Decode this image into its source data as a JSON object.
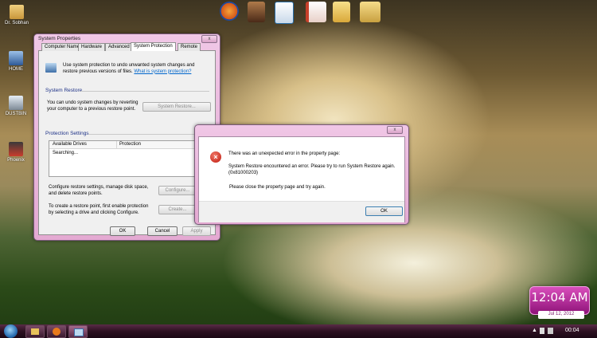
{
  "desktop": {
    "icons": [
      {
        "label": "Dr. Sobhan",
        "color": "#d9b25a"
      },
      {
        "label": "HOME",
        "color": "#4a6fa8"
      },
      {
        "label": "DUSTBIN",
        "color": "#9aa7b3"
      },
      {
        "label": "Phoenix",
        "color": "#c93c2c"
      }
    ],
    "top_launch": [
      {
        "name": "firefox-icon",
        "color": "#e87a1c"
      },
      {
        "name": "video-icon",
        "color": "#7a4a2a"
      },
      {
        "name": "app-icon",
        "color": "#2a6ea8"
      },
      {
        "name": "document-icon",
        "color": "#c8402a"
      },
      {
        "name": "folder-icon",
        "color": "#e8c25a"
      },
      {
        "name": "folder-pictures-icon",
        "color": "#d8b860"
      }
    ]
  },
  "system_properties": {
    "title": "System Properties",
    "close": "x",
    "tabs": [
      "Computer Name",
      "Hardware",
      "Advanced",
      "System Protection",
      "Remote"
    ],
    "intro": "Use system protection to undo unwanted system changes and restore previous versions of files.",
    "intro_link": "What is system protection?",
    "restore_group": "System Restore",
    "restore_text": "You can undo system changes by reverting your computer to a previous restore point.",
    "restore_button": "System Restore...",
    "protection_group": "Protection Settings",
    "columns": [
      "Available Drives",
      "Protection"
    ],
    "list_status": "Searching...",
    "configure_text": "Configure restore settings, manage disk space, and delete restore points.",
    "configure_button": "Configure...",
    "create_text": "To create a restore point, first enable protection by selecting a drive and clicking Configure.",
    "create_button": "Create...",
    "ok": "OK",
    "cancel": "Cancel",
    "apply": "Apply"
  },
  "error_dialog": {
    "close": "x",
    "heading": "There was an unexpected error in the property page:",
    "message": "System Restore encountered an error. Please try to run System Restore again. (0x81000203)",
    "note": "Please close the property page and try again.",
    "ok": "OK"
  },
  "clock_gadget": {
    "time": "12:04 AM",
    "date": "Jul 12, 2012"
  },
  "taskbar": {
    "time": "00:04",
    "colors": {
      "accent": "#b0208a"
    }
  }
}
